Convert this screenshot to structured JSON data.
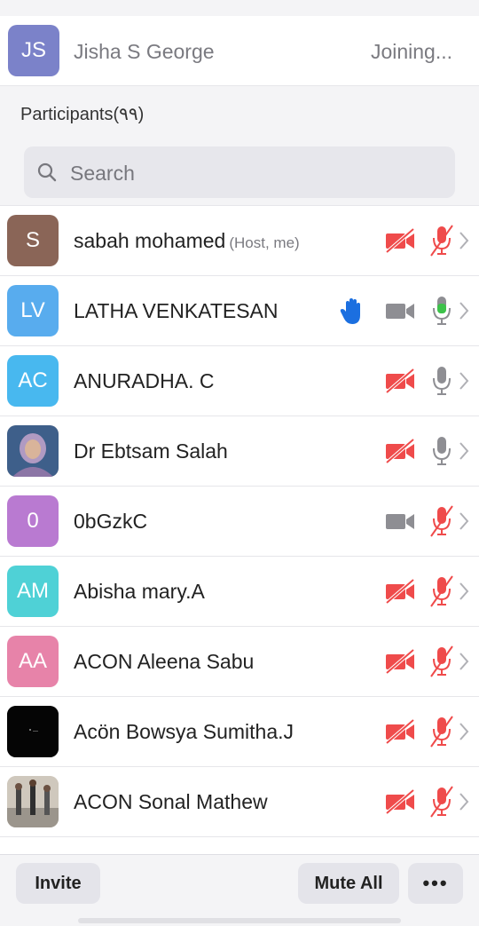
{
  "joining": {
    "initials": "JS",
    "name": "Jisha S George",
    "status": "Joining...",
    "color": "#7b82c9"
  },
  "participants_header": "Participants(٩٩)",
  "search": {
    "placeholder": "Search"
  },
  "participants": [
    {
      "initials": "S",
      "name": "sabah mohamed",
      "sub": "(Host, me)",
      "color": "#8a6557",
      "video": "off",
      "audio": "muted"
    },
    {
      "initials": "LV",
      "name": "LATHA VENKATESAN",
      "sub": "",
      "color": "#58acee",
      "video": "on",
      "audio": "speaking",
      "hand_raised": true
    },
    {
      "initials": "AC",
      "name": "ANURADHA. C",
      "sub": "",
      "color": "#48b8ef",
      "video": "off",
      "audio": "on"
    },
    {
      "initials": "",
      "name": "Dr Ebtsam Salah",
      "sub": "",
      "color": "#c9b7a6",
      "video": "off",
      "audio": "on",
      "photo": true
    },
    {
      "initials": "0",
      "name": "0bGzkC",
      "sub": "",
      "color": "#b97ad1",
      "video": "on",
      "audio": "muted"
    },
    {
      "initials": "AM",
      "name": "Abisha mary.A",
      "sub": "",
      "color": "#4fd1d6",
      "video": "off",
      "audio": "muted"
    },
    {
      "initials": "AA",
      "name": "ACON Aleena Sabu",
      "sub": "",
      "color": "#e783a9",
      "video": "off",
      "audio": "muted"
    },
    {
      "initials": "",
      "name": "Acön Bowsya Sumitha.J",
      "sub": "",
      "color": "#050505",
      "video": "off",
      "audio": "muted",
      "photo": true
    },
    {
      "initials": "",
      "name": "ACON Sonal Mathew",
      "sub": "",
      "color": "#b9b2a8",
      "video": "off",
      "audio": "muted",
      "photo": true
    }
  ],
  "footer": {
    "invite": "Invite",
    "mute_all": "Mute All",
    "more": "•••"
  },
  "colors": {
    "muted_red": "#ef4b4b",
    "speaking_green": "#3dc24a",
    "icon_gray": "#8e8e93",
    "hand_blue": "#1b6fe0"
  }
}
